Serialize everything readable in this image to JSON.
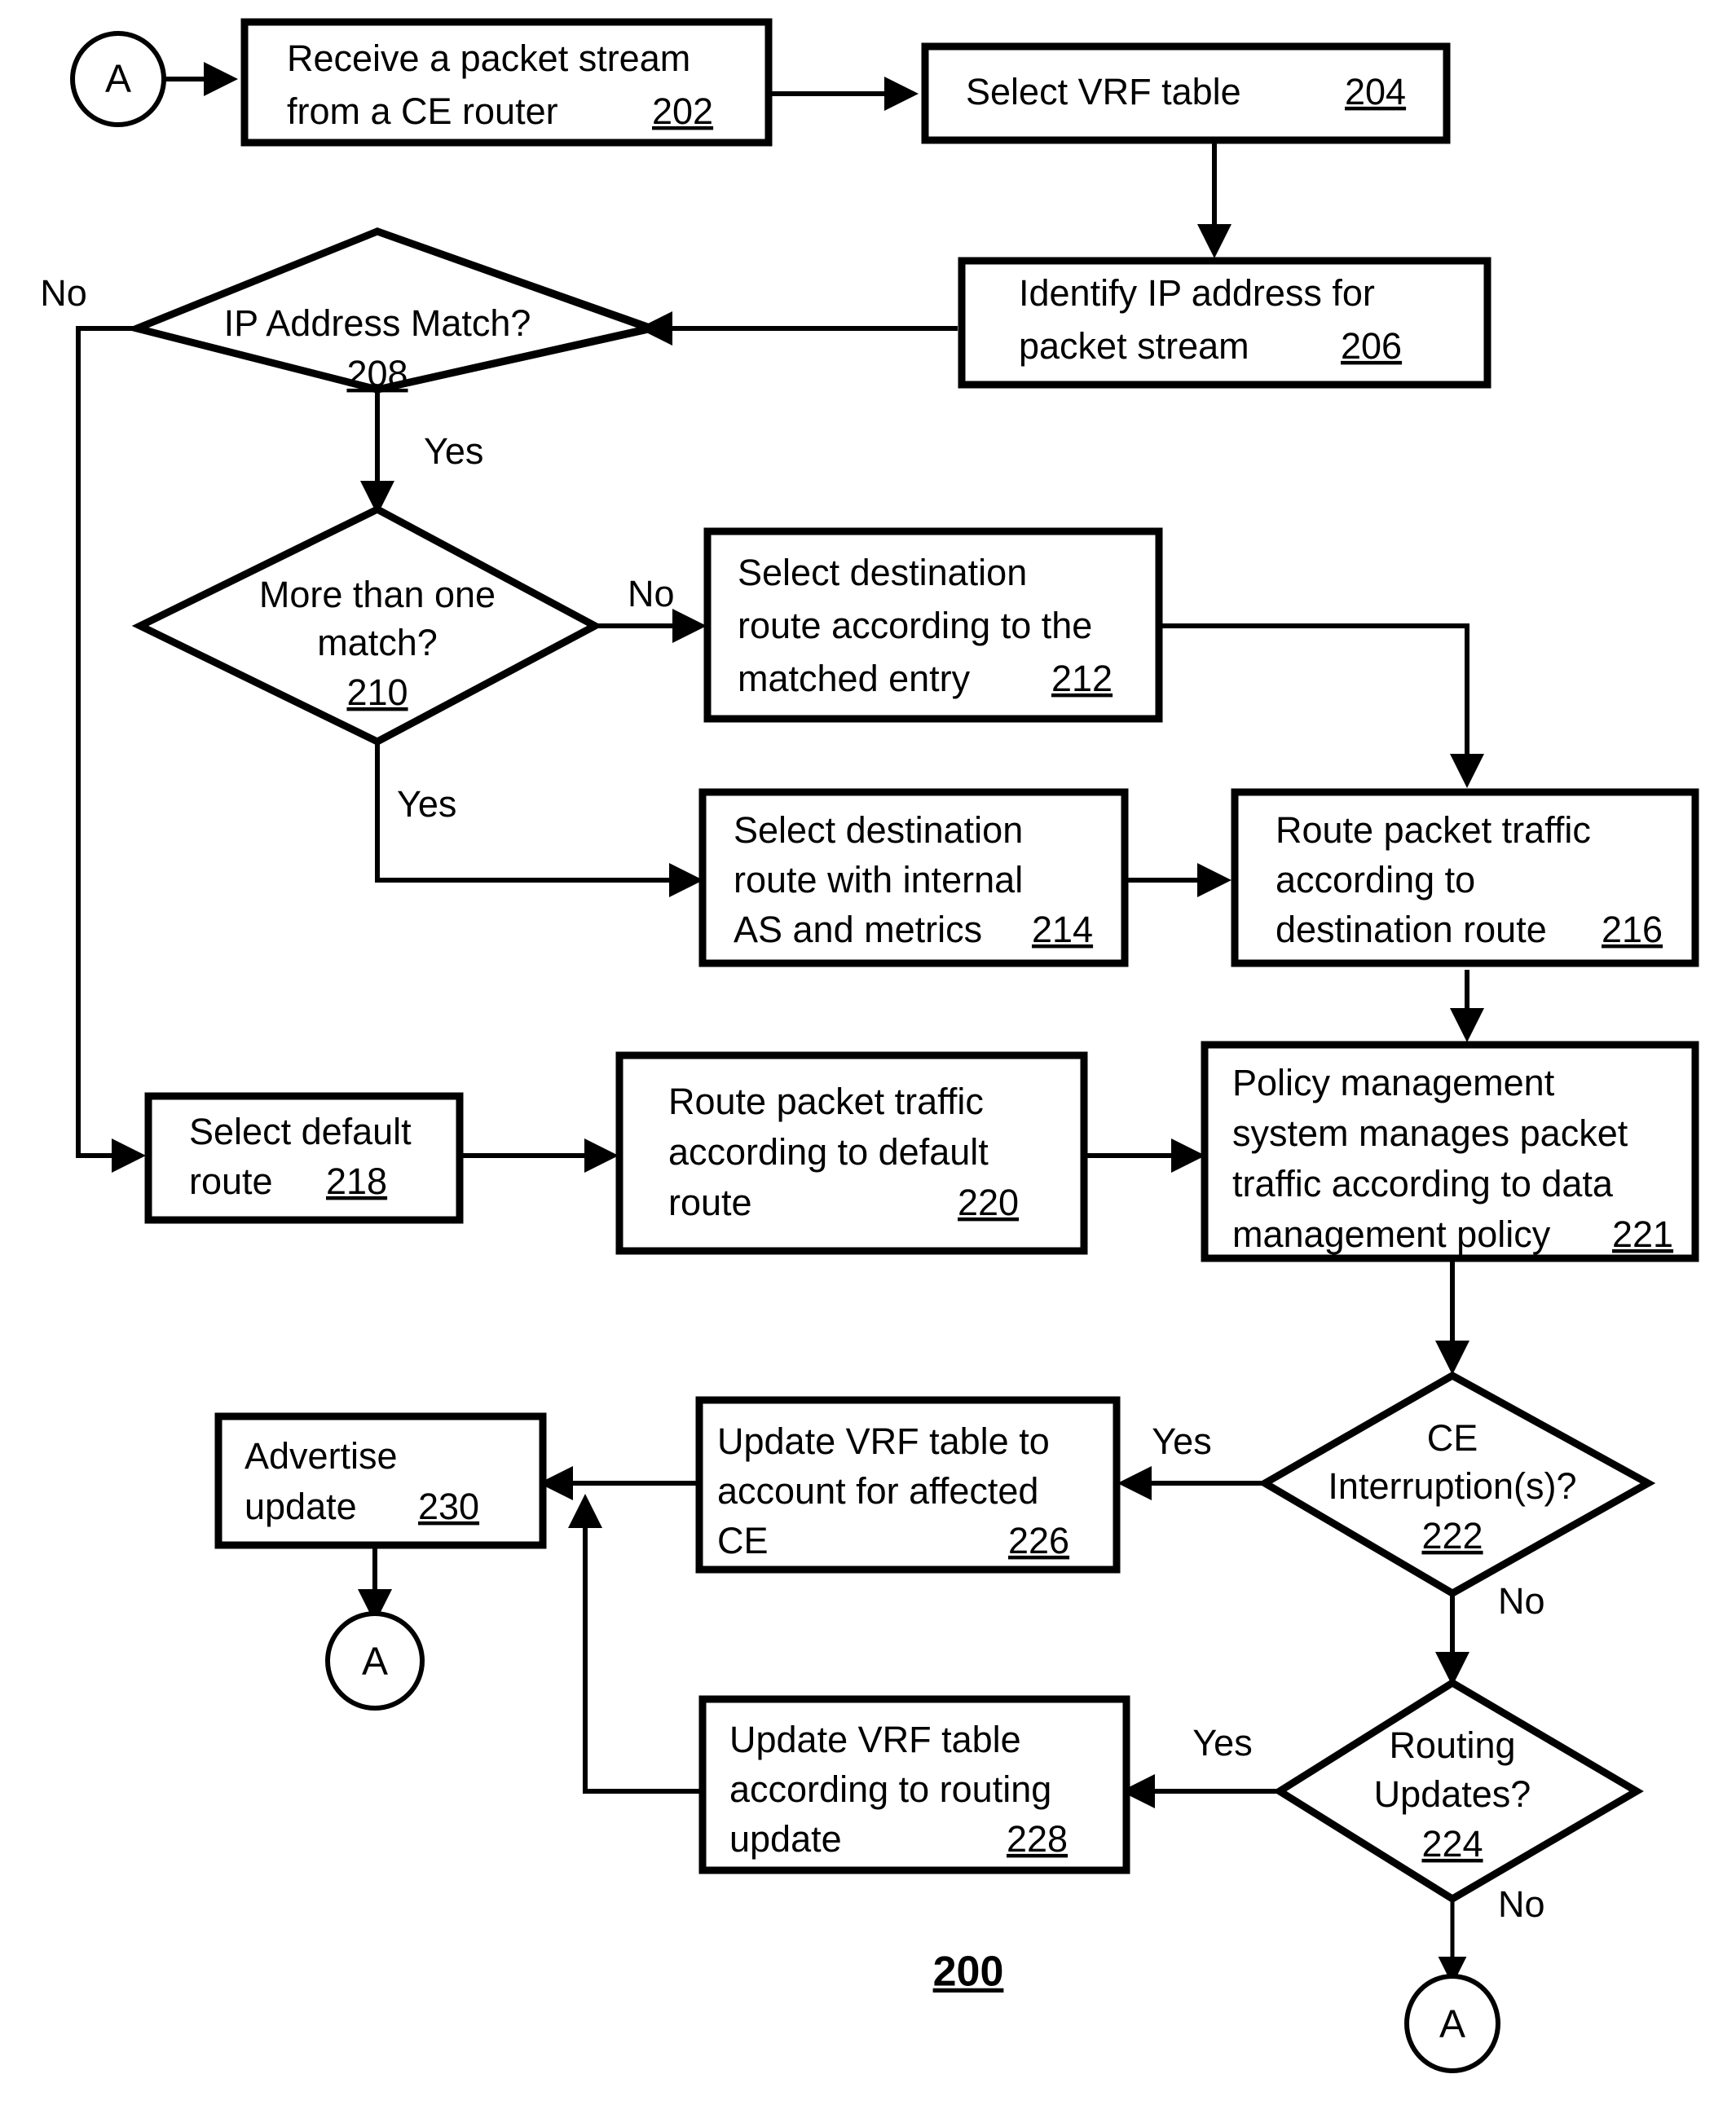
{
  "figure": {
    "number": "200",
    "type": "flowchart"
  },
  "connectors": {
    "start_label": "A",
    "end_label_1": "A",
    "end_label_2": "A"
  },
  "nodes": {
    "n202": {
      "lines": [
        "Receive a packet stream",
        "from a CE router"
      ],
      "ref": "202",
      "shape": "process"
    },
    "n204": {
      "lines": [
        "Select VRF table"
      ],
      "ref": "204",
      "shape": "process"
    },
    "n206": {
      "lines": [
        "Identify IP address for",
        "packet stream"
      ],
      "ref": "206",
      "shape": "process"
    },
    "n208": {
      "lines": [
        "IP Address Match?"
      ],
      "ref": "208",
      "shape": "decision"
    },
    "n210": {
      "lines": [
        "More than one",
        "match?"
      ],
      "ref": "210",
      "shape": "decision"
    },
    "n212": {
      "lines": [
        "Select destination",
        "route according to the",
        "matched entry"
      ],
      "ref": "212",
      "shape": "process"
    },
    "n214": {
      "lines": [
        "Select destination",
        "route with internal",
        "AS and metrics"
      ],
      "ref": "214",
      "shape": "process"
    },
    "n216": {
      "lines": [
        "Route packet traffic",
        "according to",
        "destination route"
      ],
      "ref": "216",
      "shape": "process"
    },
    "n218": {
      "lines": [
        "Select default",
        "route"
      ],
      "ref": "218",
      "shape": "process"
    },
    "n220": {
      "lines": [
        "Route packet traffic",
        "according to default",
        "route"
      ],
      "ref": "220",
      "shape": "process"
    },
    "n221": {
      "lines": [
        "Policy management",
        "system manages packet",
        "traffic according to data",
        "management policy"
      ],
      "ref": "221",
      "shape": "process"
    },
    "n222": {
      "lines": [
        "CE",
        "Interruption(s)?"
      ],
      "ref": "222",
      "shape": "decision"
    },
    "n224": {
      "lines": [
        "Routing",
        "Updates?"
      ],
      "ref": "224",
      "shape": "decision"
    },
    "n226": {
      "lines": [
        "Update VRF table to",
        "account for affected",
        "CE"
      ],
      "ref": "226",
      "shape": "process"
    },
    "n228": {
      "lines": [
        "Update VRF table",
        "according to routing",
        "update"
      ],
      "ref": "228",
      "shape": "process"
    },
    "n230": {
      "lines": [
        "Advertise",
        "update"
      ],
      "ref": "230",
      "shape": "process"
    }
  },
  "edge_labels": {
    "e208_no": "No",
    "e208_yes": "Yes",
    "e210_no": "No",
    "e210_yes": "Yes",
    "e222_yes": "Yes",
    "e222_no": "No",
    "e224_yes": "Yes",
    "e224_no": "No"
  },
  "colors": {
    "stroke": "#000000",
    "fill": "#ffffff",
    "text": "#000000"
  }
}
